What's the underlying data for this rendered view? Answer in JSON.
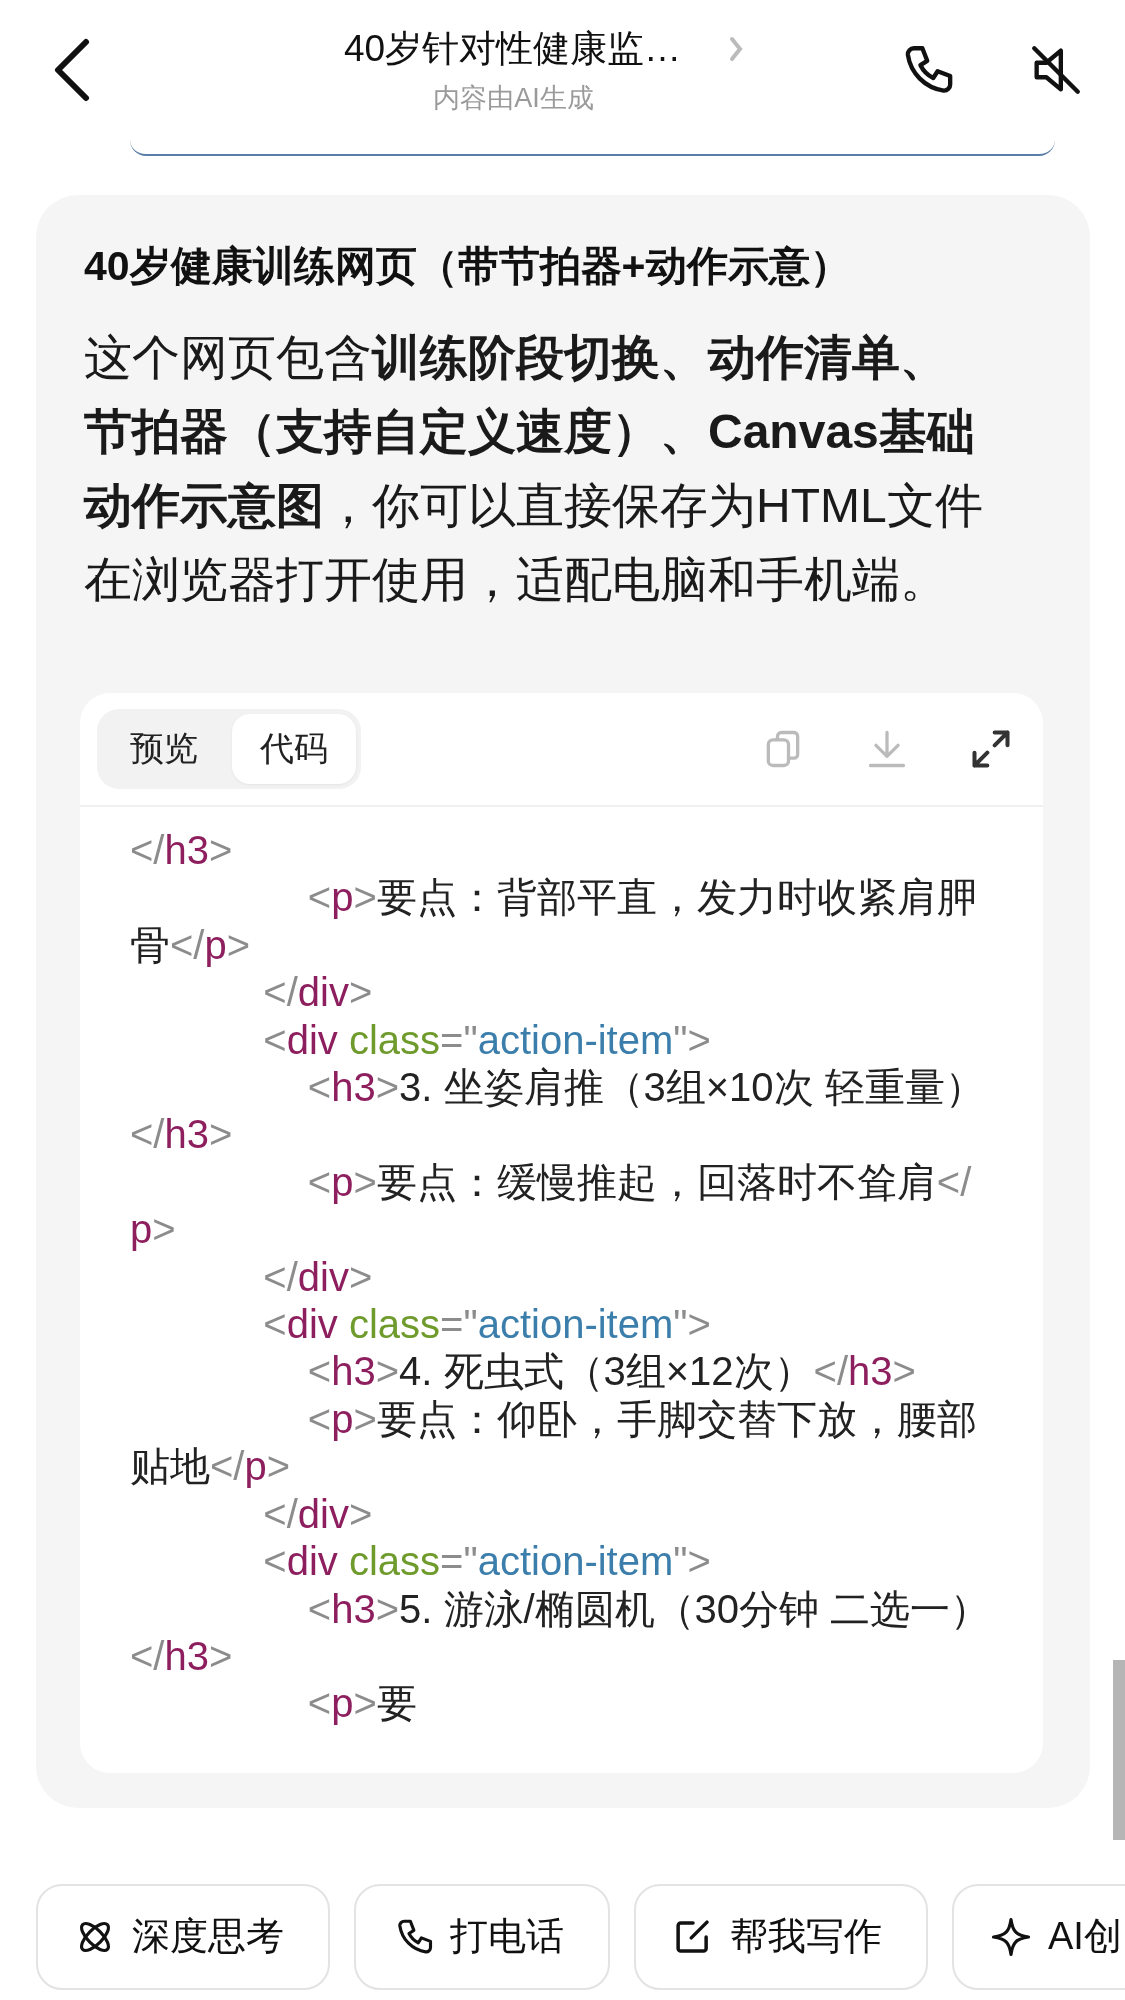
{
  "header": {
    "title": "40岁针对性健康监…",
    "subtitle": "内容由AI生成"
  },
  "message": {
    "heading": "40岁健康训练网页（带节拍器+动作示意）",
    "paragraph": "这个网页包含**训练阶段切换、动作清单、节拍器（支持自定义速度）、Canvas基础动作示意图**，你可以直接保存为HTML文件在浏览器打开使用，适配电脑和手机端。"
  },
  "code_panel": {
    "tabs": [
      {
        "label": "预览",
        "selected": false
      },
      {
        "label": "代码",
        "selected": true
      }
    ],
    "lines": [
      [
        {
          "kind": "punct",
          "text": "</"
        },
        {
          "kind": "tag",
          "text": "h3"
        },
        {
          "kind": "punct",
          "text": ">"
        }
      ],
      [
        {
          "kind": "punct",
          "text": "                <"
        },
        {
          "kind": "tag",
          "text": "p"
        },
        {
          "kind": "punct",
          "text": ">"
        },
        {
          "kind": "text",
          "text": "要点：背部平直，发力时收紧肩胛"
        }
      ],
      [
        {
          "kind": "text",
          "text": "骨"
        },
        {
          "kind": "punct",
          "text": "</"
        },
        {
          "kind": "tag",
          "text": "p"
        },
        {
          "kind": "punct",
          "text": ">"
        }
      ],
      [
        {
          "kind": "punct",
          "text": "            </"
        },
        {
          "kind": "tag",
          "text": "div"
        },
        {
          "kind": "punct",
          "text": ">"
        }
      ],
      [
        {
          "kind": "punct",
          "text": "            <"
        },
        {
          "kind": "tag",
          "text": "div "
        },
        {
          "kind": "attr",
          "text": "class"
        },
        {
          "kind": "punct",
          "text": "=\""
        },
        {
          "kind": "string",
          "text": "action-item"
        },
        {
          "kind": "punct",
          "text": "\">"
        }
      ],
      [
        {
          "kind": "punct",
          "text": "                <"
        },
        {
          "kind": "tag",
          "text": "h3"
        },
        {
          "kind": "punct",
          "text": ">"
        },
        {
          "kind": "text",
          "text": "3. 坐姿肩推（3组×10次 轻重量）"
        }
      ],
      [
        {
          "kind": "punct",
          "text": "</"
        },
        {
          "kind": "tag",
          "text": "h3"
        },
        {
          "kind": "punct",
          "text": ">"
        }
      ],
      [
        {
          "kind": "punct",
          "text": "                <"
        },
        {
          "kind": "tag",
          "text": "p"
        },
        {
          "kind": "punct",
          "text": ">"
        },
        {
          "kind": "text",
          "text": "要点：缓慢推起，回落时不耸肩"
        },
        {
          "kind": "punct",
          "text": "</"
        }
      ],
      [
        {
          "kind": "tag",
          "text": "p"
        },
        {
          "kind": "punct",
          "text": ">"
        }
      ],
      [
        {
          "kind": "punct",
          "text": "            </"
        },
        {
          "kind": "tag",
          "text": "div"
        },
        {
          "kind": "punct",
          "text": ">"
        }
      ],
      [
        {
          "kind": "punct",
          "text": "            <"
        },
        {
          "kind": "tag",
          "text": "div "
        },
        {
          "kind": "attr",
          "text": "class"
        },
        {
          "kind": "punct",
          "text": "=\""
        },
        {
          "kind": "string",
          "text": "action-item"
        },
        {
          "kind": "punct",
          "text": "\">"
        }
      ],
      [
        {
          "kind": "punct",
          "text": "                <"
        },
        {
          "kind": "tag",
          "text": "h3"
        },
        {
          "kind": "punct",
          "text": ">"
        },
        {
          "kind": "text",
          "text": "4. 死虫式（3组×12次）"
        },
        {
          "kind": "punct",
          "text": "</"
        },
        {
          "kind": "tag",
          "text": "h3"
        },
        {
          "kind": "punct",
          "text": ">"
        }
      ],
      [
        {
          "kind": "punct",
          "text": "                <"
        },
        {
          "kind": "tag",
          "text": "p"
        },
        {
          "kind": "punct",
          "text": ">"
        },
        {
          "kind": "text",
          "text": "要点：仰卧，手脚交替下放，腰部"
        }
      ],
      [
        {
          "kind": "text",
          "text": "贴地"
        },
        {
          "kind": "punct",
          "text": "</"
        },
        {
          "kind": "tag",
          "text": "p"
        },
        {
          "kind": "punct",
          "text": ">"
        }
      ],
      [
        {
          "kind": "punct",
          "text": "            </"
        },
        {
          "kind": "tag",
          "text": "div"
        },
        {
          "kind": "punct",
          "text": ">"
        }
      ],
      [
        {
          "kind": "punct",
          "text": "            <"
        },
        {
          "kind": "tag",
          "text": "div "
        },
        {
          "kind": "attr",
          "text": "class"
        },
        {
          "kind": "punct",
          "text": "=\""
        },
        {
          "kind": "string",
          "text": "action-item"
        },
        {
          "kind": "punct",
          "text": "\">"
        }
      ],
      [
        {
          "kind": "punct",
          "text": "                <"
        },
        {
          "kind": "tag",
          "text": "h3"
        },
        {
          "kind": "punct",
          "text": ">"
        },
        {
          "kind": "text",
          "text": "5. 游泳/椭圆机（30分钟 二选一）"
        }
      ],
      [
        {
          "kind": "punct",
          "text": "</"
        },
        {
          "kind": "tag",
          "text": "h3"
        },
        {
          "kind": "punct",
          "text": ">"
        }
      ],
      [
        {
          "kind": "punct",
          "text": "                <"
        },
        {
          "kind": "tag",
          "text": "p"
        },
        {
          "kind": "punct",
          "text": ">"
        },
        {
          "kind": "text",
          "text": "要"
        }
      ]
    ]
  },
  "chips": [
    {
      "kind": "atom",
      "label": "深度思考"
    },
    {
      "kind": "phone",
      "label": "打电话"
    },
    {
      "kind": "edit",
      "label": "帮我写作"
    },
    {
      "kind": "sparkle",
      "label": "AI创"
    }
  ]
}
